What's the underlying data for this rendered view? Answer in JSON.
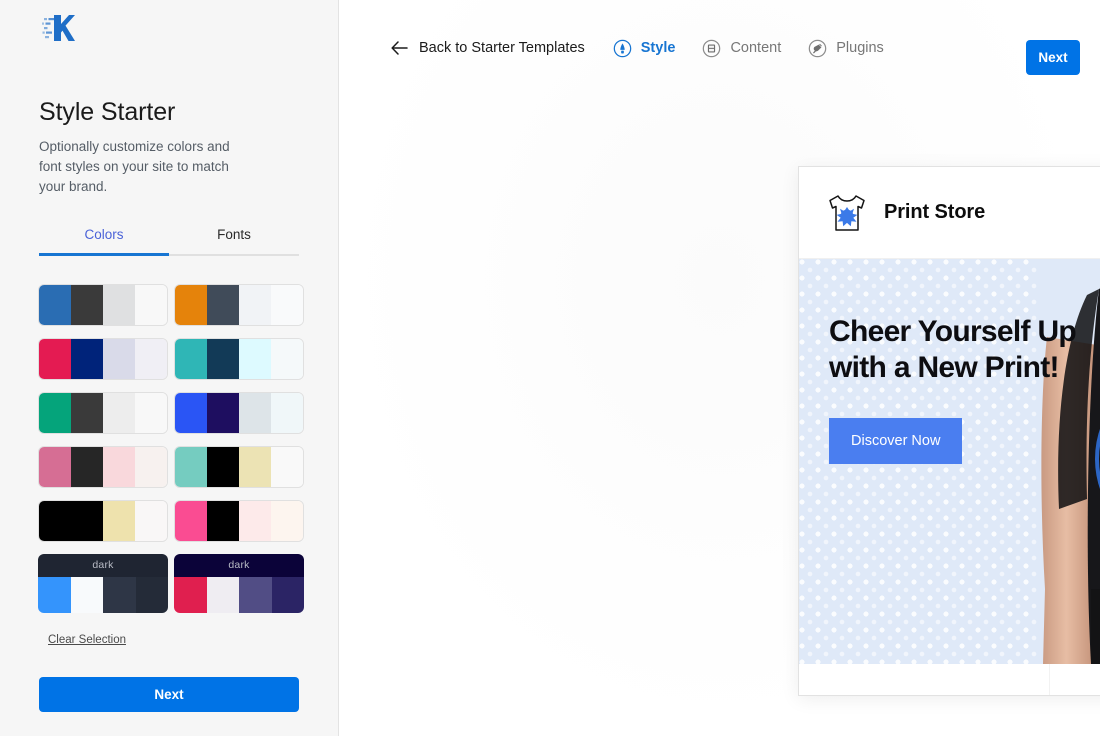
{
  "sidebar": {
    "logo_icon": "kadence-k-logo",
    "title": "Style Starter",
    "subtitle": "Optionally customize colors and font styles on your site to match your brand.",
    "tabs": [
      {
        "label": "Colors",
        "active": true
      },
      {
        "label": "Fonts",
        "active": false
      }
    ],
    "palettes": [
      {
        "id": "palette-1",
        "dark": false,
        "colors": [
          "#2a6db3",
          "#3a3a3a",
          "#dfe0e1",
          "#f8f8f8"
        ]
      },
      {
        "id": "palette-2",
        "dark": false,
        "colors": [
          "#e5830b",
          "#404b59",
          "#f1f3f6",
          "#f9fafb"
        ]
      },
      {
        "id": "palette-3",
        "dark": false,
        "colors": [
          "#e41b52",
          "#00237a",
          "#d9dae9",
          "#f0eff5"
        ]
      },
      {
        "id": "palette-4",
        "dark": false,
        "colors": [
          "#2fb6b6",
          "#123a57",
          "#ddfaff",
          "#f5f9fa"
        ]
      },
      {
        "id": "palette-5",
        "dark": false,
        "colors": [
          "#05a47b",
          "#3a3a3a",
          "#ededed",
          "#f8f8f8"
        ]
      },
      {
        "id": "palette-6",
        "dark": false,
        "colors": [
          "#2a55f5",
          "#1e0e60",
          "#dde4e8",
          "#f0f7f9"
        ]
      },
      {
        "id": "palette-7",
        "dark": false,
        "colors": [
          "#d66e94",
          "#262626",
          "#f9d8dc",
          "#f7f1ef"
        ]
      },
      {
        "id": "palette-8",
        "dark": false,
        "colors": [
          "#75ccc0",
          "#000000",
          "#ece3b4",
          "#f9f9f9"
        ]
      },
      {
        "id": "palette-9",
        "dark": false,
        "colors": [
          "#000000",
          "#000000",
          "#eee2ad",
          "#f9f7f7"
        ]
      },
      {
        "id": "palette-10",
        "dark": false,
        "colors": [
          "#fa4c92",
          "#000000",
          "#fdeaea",
          "#fdf5ef"
        ]
      },
      {
        "id": "palette-11",
        "dark": true,
        "label": "dark",
        "bar": "#1f2532",
        "colors": [
          "#3494fc",
          "#f8fafc",
          "#2e3646",
          "#242b38"
        ]
      },
      {
        "id": "palette-12",
        "dark": true,
        "label": "dark",
        "bar": "#0b0339",
        "colors": [
          "#e01f4f",
          "#efedf2",
          "#514d85",
          "#2b2465"
        ]
      }
    ],
    "clear_selection": "Clear Selection",
    "next_label": "Next"
  },
  "topbar": {
    "back_label": "Back to Starter Templates",
    "back_icon": "arrow-left-icon",
    "nav": [
      {
        "label": "Style",
        "icon": "style-brush-icon",
        "active": true
      },
      {
        "label": "Content",
        "icon": "content-page-icon",
        "active": false
      },
      {
        "label": "Plugins",
        "icon": "plugins-plug-icon",
        "active": false
      }
    ],
    "next_label": "Next"
  },
  "preview": {
    "site_name": "Print Store",
    "logo_icon": "tshirt-ink-splat-logo",
    "menu_icon": "hamburger-menu-icon",
    "hero": {
      "heading": "Cheer Yourself Up with a New Print!",
      "cta_label": "Discover Now",
      "image_alt": "man-wearing-black-tshirt-with-neon-swirl-print"
    },
    "scrollbar": {
      "up_icon": "scroll-up-arrow-icon",
      "down_icon": "scroll-down-arrow-icon"
    }
  },
  "colors": {
    "accent_blue": "#0073e6",
    "link_blue": "#1775d2",
    "tab_active": "#4a62d8",
    "hero_cta": "#4a7ef0",
    "hero_bg": "#dfe9f8"
  }
}
